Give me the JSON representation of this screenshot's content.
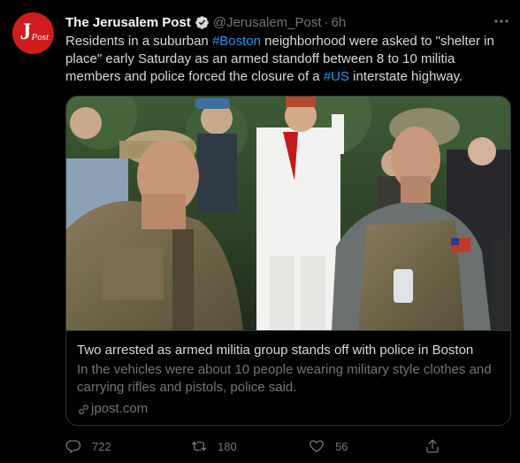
{
  "colors": {
    "background": "#000000",
    "accent": "#1d9bf0",
    "muted": "#6e767d",
    "avatar_red": "#d01c1c"
  },
  "tweet": {
    "avatar_icon": "jerusalem-post-logo",
    "avatar_text_main": "J",
    "avatar_text_sub": "Post",
    "author_name": "The Jerusalem Post",
    "verified_icon": "verified-badge-icon",
    "handle": "@Jerusalem_Post",
    "separator": "·",
    "time": "6h",
    "more_icon": "more-options-icon",
    "text": {
      "part1": "Residents in a suburban ",
      "hashtag1": "#Boston",
      "part2": " neighborhood were asked to \"shelter in place\" early Saturday as an armed standoff between 8 to 10 militia members and police forced the closure of a ",
      "hashtag2": "#US",
      "part3": " interstate highway."
    }
  },
  "card": {
    "image_alt": "armed-militia-members-photo",
    "title": "Two arrested as armed militia group stands off with police in Boston",
    "description": "In the vehicles were about 10 people wearing military style clothes and carrying rifles and pistols, police said.",
    "domain": "jpost.com",
    "domain_icon": "link-icon"
  },
  "actions": {
    "reply": {
      "icon": "reply-icon",
      "count": "722"
    },
    "retweet": {
      "icon": "retweet-icon",
      "count": "180"
    },
    "like": {
      "icon": "heart-icon",
      "count": "56"
    },
    "share": {
      "icon": "share-icon"
    }
  }
}
